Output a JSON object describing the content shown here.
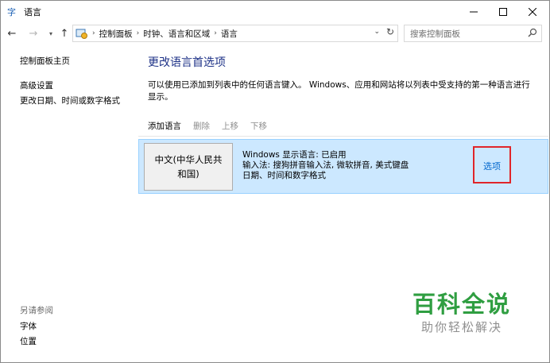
{
  "window": {
    "title": "语言",
    "icon": "language-icon"
  },
  "nav": {
    "back": "←",
    "forward": "→",
    "recent": "▾",
    "up": "↑"
  },
  "breadcrumb": [
    "控制面板",
    "时钟、语言和区域",
    "语言"
  ],
  "search": {
    "placeholder": "搜索控制面板"
  },
  "sidebar": {
    "links": [
      "控制面板主页",
      "高级设置",
      "更改日期、时间或数字格式"
    ],
    "see_also_heading": "另请参阅",
    "see_also": [
      "字体",
      "位置"
    ]
  },
  "main": {
    "title": "更改语言首选项",
    "description": "可以使用已添加到列表中的任何语言键入。 Windows、应用和网站将以列表中受支持的第一种语言进行显示。",
    "toolbar": {
      "add": "添加语言",
      "remove": "删除",
      "up": "上移",
      "down": "下移"
    },
    "language": {
      "name_line1": "中文(中华人民共",
      "name_line2": "和国)",
      "detail1": "Windows 显示语言: 已启用",
      "detail2": "输入法: 搜狗拼音输入法, 微软拼音, 美式键盘",
      "detail3": "日期、时间和数字格式",
      "options": "选项"
    }
  },
  "watermark": {
    "title": "百科全说",
    "subtitle": "助你轻松解决"
  },
  "colors": {
    "accent_title": "#1e3287",
    "link": "#0066cc",
    "selection": "#cce8ff",
    "highlight": "#e0252a",
    "watermark": "#2f9e41"
  }
}
